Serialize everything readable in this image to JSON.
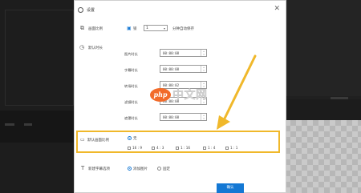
{
  "dialog": {
    "title": "设置",
    "close_glyph": "✕",
    "ok_label": "确认"
  },
  "sections": {
    "ratio": {
      "label": "画面比例",
      "lock_label": "锁",
      "value": "1",
      "hint": "分钟自动保存"
    },
    "time": {
      "label": "默认时长",
      "rows": [
        {
          "label": "图片时长",
          "value": "00:00:08"
        },
        {
          "label": "字幕时长",
          "value": "00:00:08"
        },
        {
          "label": "转场时长",
          "value": "00:00:02"
        },
        {
          "label": "滤镜时长",
          "value": "00:00:08"
        },
        {
          "label": "遮罩时长",
          "value": "00:00:08"
        }
      ]
    },
    "aspect": {
      "label": "默认画面比例",
      "default_option": "无",
      "options": [
        "16 : 9",
        "4 : 3",
        "1 : 16",
        "1 : 4",
        "1 : 1"
      ]
    },
    "subtitle": {
      "label": "新建字幕选项",
      "options": [
        {
          "label": "添加图片",
          "selected": true
        },
        {
          "label": "固定",
          "selected": false
        }
      ]
    }
  },
  "watermark": {
    "logo": "php",
    "text": "中文网"
  },
  "colors": {
    "accent": "#1478d4",
    "highlight": "#f0b82b"
  }
}
